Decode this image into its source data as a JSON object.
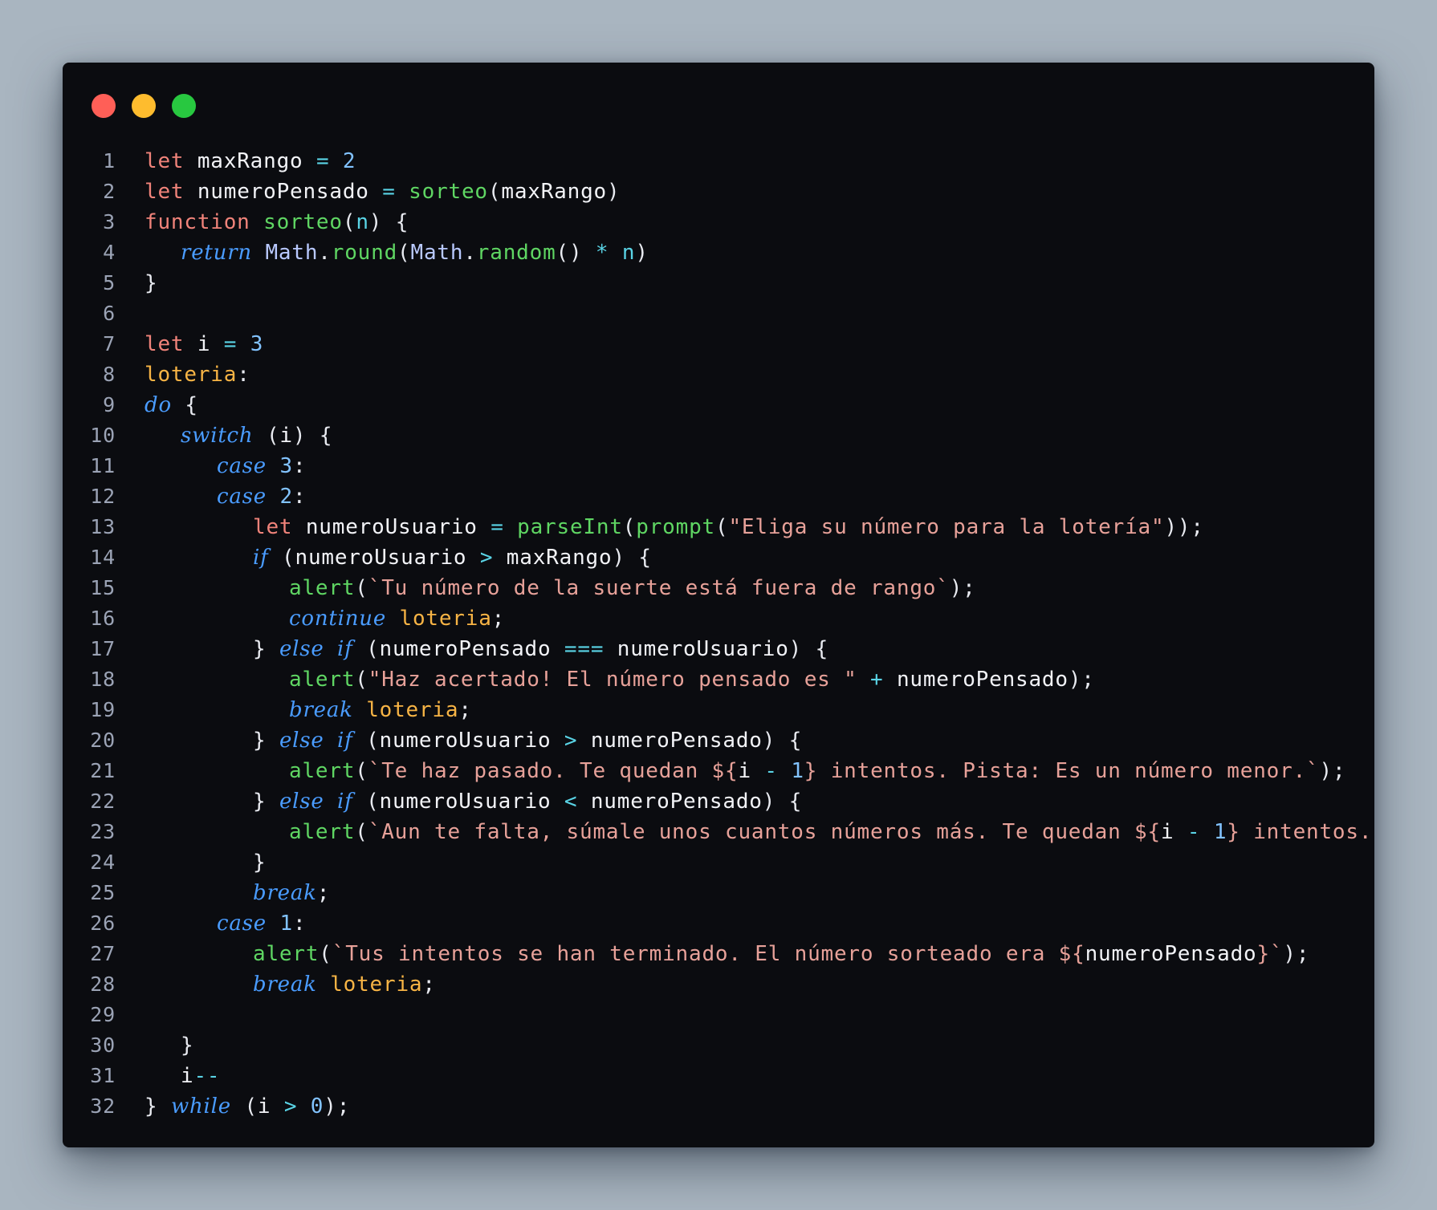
{
  "window": {
    "traffic_lights": [
      {
        "name": "close",
        "color": "#ff5f57"
      },
      {
        "name": "minimize",
        "color": "#febc2e"
      },
      {
        "name": "maximize",
        "color": "#28c840"
      }
    ]
  },
  "code": {
    "language": "javascript",
    "lines": [
      {
        "n": "1",
        "indent": 0,
        "tokens": [
          [
            "kw",
            "let"
          ],
          [
            "t",
            " "
          ],
          [
            "var",
            "maxRango"
          ],
          [
            "t",
            " "
          ],
          [
            "op",
            "="
          ],
          [
            "t",
            " "
          ],
          [
            "num",
            "2"
          ]
        ]
      },
      {
        "n": "2",
        "indent": 0,
        "tokens": [
          [
            "kw",
            "let"
          ],
          [
            "t",
            " "
          ],
          [
            "var",
            "numeroPensado"
          ],
          [
            "t",
            " "
          ],
          [
            "op",
            "="
          ],
          [
            "t",
            " "
          ],
          [
            "fn",
            "sorteo"
          ],
          [
            "punc",
            "("
          ],
          [
            "var",
            "maxRango"
          ],
          [
            "punc",
            ")"
          ]
        ]
      },
      {
        "n": "3",
        "indent": 0,
        "tokens": [
          [
            "kw",
            "function"
          ],
          [
            "t",
            " "
          ],
          [
            "fn",
            "sorteo"
          ],
          [
            "punc",
            "("
          ],
          [
            "param",
            "n"
          ],
          [
            "punc",
            ")"
          ],
          [
            "t",
            " "
          ],
          [
            "punc",
            "{"
          ]
        ]
      },
      {
        "n": "4",
        "indent": 1,
        "tokens": [
          [
            "kwi",
            "return"
          ],
          [
            "t",
            " "
          ],
          [
            "obj",
            "Math"
          ],
          [
            "punc",
            "."
          ],
          [
            "fn",
            "round"
          ],
          [
            "punc",
            "("
          ],
          [
            "obj",
            "Math"
          ],
          [
            "punc",
            "."
          ],
          [
            "fn",
            "random"
          ],
          [
            "punc",
            "()"
          ],
          [
            "t",
            " "
          ],
          [
            "op",
            "*"
          ],
          [
            "t",
            " "
          ],
          [
            "param",
            "n"
          ],
          [
            "punc",
            ")"
          ]
        ]
      },
      {
        "n": "5",
        "indent": 0,
        "tokens": [
          [
            "punc",
            "}"
          ]
        ]
      },
      {
        "n": "6",
        "indent": 0,
        "tokens": []
      },
      {
        "n": "7",
        "indent": 0,
        "tokens": [
          [
            "kw",
            "let"
          ],
          [
            "t",
            " "
          ],
          [
            "var",
            "i"
          ],
          [
            "t",
            " "
          ],
          [
            "op",
            "="
          ],
          [
            "t",
            " "
          ],
          [
            "num",
            "3"
          ]
        ]
      },
      {
        "n": "8",
        "indent": 0,
        "tokens": [
          [
            "label",
            "loteria"
          ],
          [
            "punc",
            ":"
          ]
        ]
      },
      {
        "n": "9",
        "indent": 0,
        "tokens": [
          [
            "kwi",
            "do"
          ],
          [
            "t",
            " "
          ],
          [
            "punc",
            "{"
          ]
        ]
      },
      {
        "n": "10",
        "indent": 1,
        "tokens": [
          [
            "kwi",
            "switch"
          ],
          [
            "t",
            " "
          ],
          [
            "punc",
            "("
          ],
          [
            "var",
            "i"
          ],
          [
            "punc",
            ")"
          ],
          [
            "t",
            " "
          ],
          [
            "punc",
            "{"
          ]
        ]
      },
      {
        "n": "11",
        "indent": 2,
        "tokens": [
          [
            "kwi",
            "case"
          ],
          [
            "t",
            " "
          ],
          [
            "num",
            "3"
          ],
          [
            "punc",
            ":"
          ]
        ]
      },
      {
        "n": "12",
        "indent": 2,
        "tokens": [
          [
            "kwi",
            "case"
          ],
          [
            "t",
            " "
          ],
          [
            "num",
            "2"
          ],
          [
            "punc",
            ":"
          ]
        ]
      },
      {
        "n": "13",
        "indent": 3,
        "tokens": [
          [
            "kw",
            "let"
          ],
          [
            "t",
            " "
          ],
          [
            "var",
            "numeroUsuario"
          ],
          [
            "t",
            " "
          ],
          [
            "op",
            "="
          ],
          [
            "t",
            " "
          ],
          [
            "fn",
            "parseInt"
          ],
          [
            "punc",
            "("
          ],
          [
            "fn",
            "prompt"
          ],
          [
            "punc",
            "("
          ],
          [
            "str",
            "\"Eliga su número para la lotería\""
          ],
          [
            "punc",
            "));"
          ]
        ]
      },
      {
        "n": "14",
        "indent": 3,
        "tokens": [
          [
            "kwi",
            "if"
          ],
          [
            "t",
            " "
          ],
          [
            "punc",
            "("
          ],
          [
            "var",
            "numeroUsuario"
          ],
          [
            "t",
            " "
          ],
          [
            "op",
            ">"
          ],
          [
            "t",
            " "
          ],
          [
            "var",
            "maxRango"
          ],
          [
            "punc",
            ")"
          ],
          [
            "t",
            " "
          ],
          [
            "punc",
            "{"
          ]
        ]
      },
      {
        "n": "15",
        "indent": 4,
        "tokens": [
          [
            "fn",
            "alert"
          ],
          [
            "punc",
            "("
          ],
          [
            "str",
            "`Tu número de la suerte está fuera de rango`"
          ],
          [
            "punc",
            ");"
          ]
        ]
      },
      {
        "n": "16",
        "indent": 4,
        "tokens": [
          [
            "kwi",
            "continue"
          ],
          [
            "t",
            " "
          ],
          [
            "label",
            "loteria"
          ],
          [
            "punc",
            ";"
          ]
        ]
      },
      {
        "n": "17",
        "indent": 3,
        "tokens": [
          [
            "punc",
            "}"
          ],
          [
            "t",
            " "
          ],
          [
            "kwi",
            "else"
          ],
          [
            "t",
            " "
          ],
          [
            "kwi",
            "if"
          ],
          [
            "t",
            " "
          ],
          [
            "punc",
            "("
          ],
          [
            "var",
            "numeroPensado"
          ],
          [
            "t",
            " "
          ],
          [
            "op",
            "==="
          ],
          [
            "t",
            " "
          ],
          [
            "var",
            "numeroUsuario"
          ],
          [
            "punc",
            ")"
          ],
          [
            "t",
            " "
          ],
          [
            "punc",
            "{"
          ]
        ]
      },
      {
        "n": "18",
        "indent": 4,
        "tokens": [
          [
            "fn",
            "alert"
          ],
          [
            "punc",
            "("
          ],
          [
            "str",
            "\"Haz acertado! El número pensado es \""
          ],
          [
            "t",
            " "
          ],
          [
            "op",
            "+"
          ],
          [
            "t",
            " "
          ],
          [
            "var",
            "numeroPensado"
          ],
          [
            "punc",
            ");"
          ]
        ]
      },
      {
        "n": "19",
        "indent": 4,
        "tokens": [
          [
            "kwi",
            "break"
          ],
          [
            "t",
            " "
          ],
          [
            "label",
            "loteria"
          ],
          [
            "punc",
            ";"
          ]
        ]
      },
      {
        "n": "20",
        "indent": 3,
        "tokens": [
          [
            "punc",
            "}"
          ],
          [
            "t",
            " "
          ],
          [
            "kwi",
            "else"
          ],
          [
            "t",
            " "
          ],
          [
            "kwi",
            "if"
          ],
          [
            "t",
            " "
          ],
          [
            "punc",
            "("
          ],
          [
            "var",
            "numeroUsuario"
          ],
          [
            "t",
            " "
          ],
          [
            "op",
            ">"
          ],
          [
            "t",
            " "
          ],
          [
            "var",
            "numeroPensado"
          ],
          [
            "punc",
            ")"
          ],
          [
            "t",
            " "
          ],
          [
            "punc",
            "{"
          ]
        ]
      },
      {
        "n": "21",
        "indent": 4,
        "tokens": [
          [
            "fn",
            "alert"
          ],
          [
            "punc",
            "("
          ],
          [
            "str",
            "`Te haz pasado. Te quedan ${"
          ],
          [
            "var",
            "i"
          ],
          [
            "t",
            " "
          ],
          [
            "op",
            "-"
          ],
          [
            "t",
            " "
          ],
          [
            "num",
            "1"
          ],
          [
            "str",
            "} intentos. Pista: Es un número menor.`"
          ],
          [
            "punc",
            ");"
          ]
        ]
      },
      {
        "n": "22",
        "indent": 3,
        "tokens": [
          [
            "punc",
            "}"
          ],
          [
            "t",
            " "
          ],
          [
            "kwi",
            "else"
          ],
          [
            "t",
            " "
          ],
          [
            "kwi",
            "if"
          ],
          [
            "t",
            " "
          ],
          [
            "punc",
            "("
          ],
          [
            "var",
            "numeroUsuario"
          ],
          [
            "t",
            " "
          ],
          [
            "op",
            "<"
          ],
          [
            "t",
            " "
          ],
          [
            "var",
            "numeroPensado"
          ],
          [
            "punc",
            ")"
          ],
          [
            "t",
            " "
          ],
          [
            "punc",
            "{"
          ]
        ]
      },
      {
        "n": "23",
        "indent": 4,
        "tokens": [
          [
            "fn",
            "alert"
          ],
          [
            "punc",
            "("
          ],
          [
            "str",
            "`Aun te falta, súmale unos cuantos números más. Te quedan ${"
          ],
          [
            "var",
            "i"
          ],
          [
            "t",
            " "
          ],
          [
            "op",
            "-"
          ],
          [
            "t",
            " "
          ],
          [
            "num",
            "1"
          ],
          [
            "str",
            "} intentos.`"
          ],
          [
            "punc",
            ");"
          ]
        ]
      },
      {
        "n": "24",
        "indent": 3,
        "tokens": [
          [
            "punc",
            "}"
          ]
        ]
      },
      {
        "n": "25",
        "indent": 3,
        "tokens": [
          [
            "kwi",
            "break"
          ],
          [
            "punc",
            ";"
          ]
        ]
      },
      {
        "n": "26",
        "indent": 2,
        "tokens": [
          [
            "kwi",
            "case"
          ],
          [
            "t",
            " "
          ],
          [
            "num",
            "1"
          ],
          [
            "punc",
            ":"
          ]
        ]
      },
      {
        "n": "27",
        "indent": 3,
        "tokens": [
          [
            "fn",
            "alert"
          ],
          [
            "punc",
            "("
          ],
          [
            "str",
            "`Tus intentos se han terminado. El número sorteado era ${"
          ],
          [
            "var",
            "numeroPensado"
          ],
          [
            "str",
            "}`"
          ],
          [
            "punc",
            ");"
          ]
        ]
      },
      {
        "n": "28",
        "indent": 3,
        "tokens": [
          [
            "kwi",
            "break"
          ],
          [
            "t",
            " "
          ],
          [
            "label",
            "loteria"
          ],
          [
            "punc",
            ";"
          ]
        ]
      },
      {
        "n": "29",
        "indent": 0,
        "tokens": []
      },
      {
        "n": "30",
        "indent": 1,
        "tokens": [
          [
            "punc",
            "}"
          ]
        ]
      },
      {
        "n": "31",
        "indent": 1,
        "tokens": [
          [
            "var",
            "i"
          ],
          [
            "op",
            "--"
          ]
        ]
      },
      {
        "n": "32",
        "indent": 0,
        "tokens": [
          [
            "punc",
            "}"
          ],
          [
            "t",
            " "
          ],
          [
            "kwi",
            "while"
          ],
          [
            "t",
            " "
          ],
          [
            "punc",
            "("
          ],
          [
            "var",
            "i"
          ],
          [
            "t",
            " "
          ],
          [
            "op",
            ">"
          ],
          [
            "t",
            " "
          ],
          [
            "num",
            "0"
          ],
          [
            "punc",
            ");"
          ]
        ]
      }
    ]
  }
}
